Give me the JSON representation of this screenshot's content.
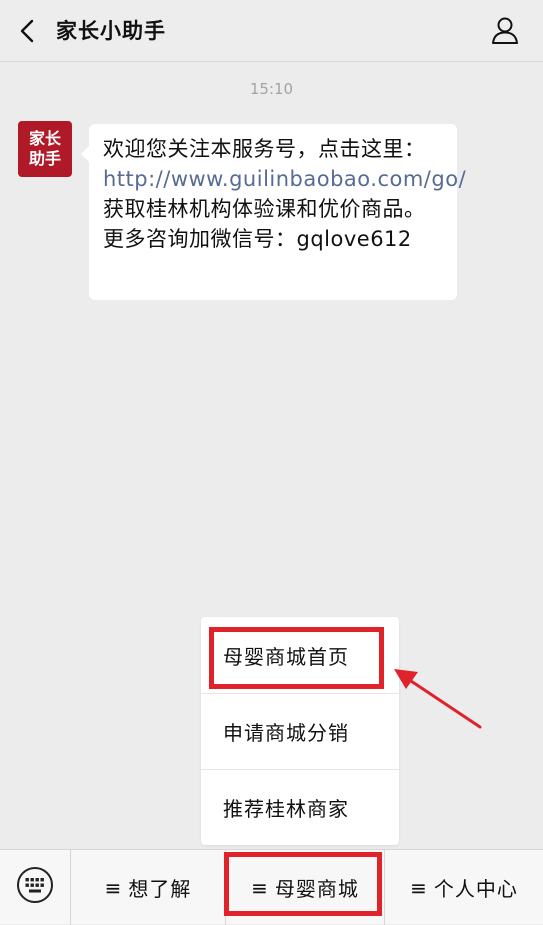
{
  "header": {
    "title": "家长小助手"
  },
  "chat": {
    "time": "15:10",
    "avatar_lines": [
      "家长",
      "助手"
    ],
    "message": {
      "part1": "欢迎您关注本服务号，点击这里：",
      "link": "http://www.guilinbaobao.com/go/",
      "part2": "获取桂林机构体验课和优价商品。更多咨询加微信号：gqlove612"
    }
  },
  "submenu": {
    "items": [
      "母婴商城首页",
      "申请商城分销",
      "推荐桂林商家"
    ]
  },
  "bottom_menu": {
    "tabs": [
      {
        "icon": "≡",
        "label": "想了解"
      },
      {
        "icon": "≡",
        "label": "母婴商城"
      },
      {
        "icon": "≡",
        "label": "个人中心"
      }
    ]
  },
  "colors": {
    "highlight": "#e0222a",
    "avatar_bg": "#b01927",
    "link": "#576b95"
  }
}
